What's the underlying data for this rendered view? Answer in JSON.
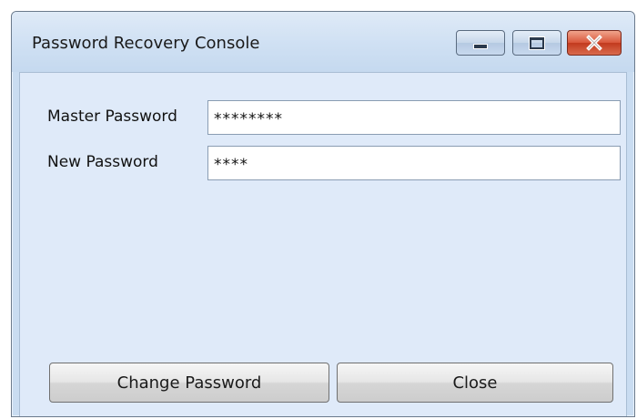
{
  "window": {
    "title": "Password Recovery Console"
  },
  "form": {
    "master_label": "Master Password",
    "master_value": "********",
    "new_label": "New Password",
    "new_value": "****"
  },
  "buttons": {
    "change_password": "Change Password",
    "close": "Close"
  },
  "colors": {
    "titlebar": "#cfe0f3",
    "client_bg": "#dfeaf9",
    "close_button": "#d9563a"
  },
  "icons": {
    "minimize": "minimize-icon",
    "maximize": "maximize-icon",
    "close": "close-icon"
  }
}
